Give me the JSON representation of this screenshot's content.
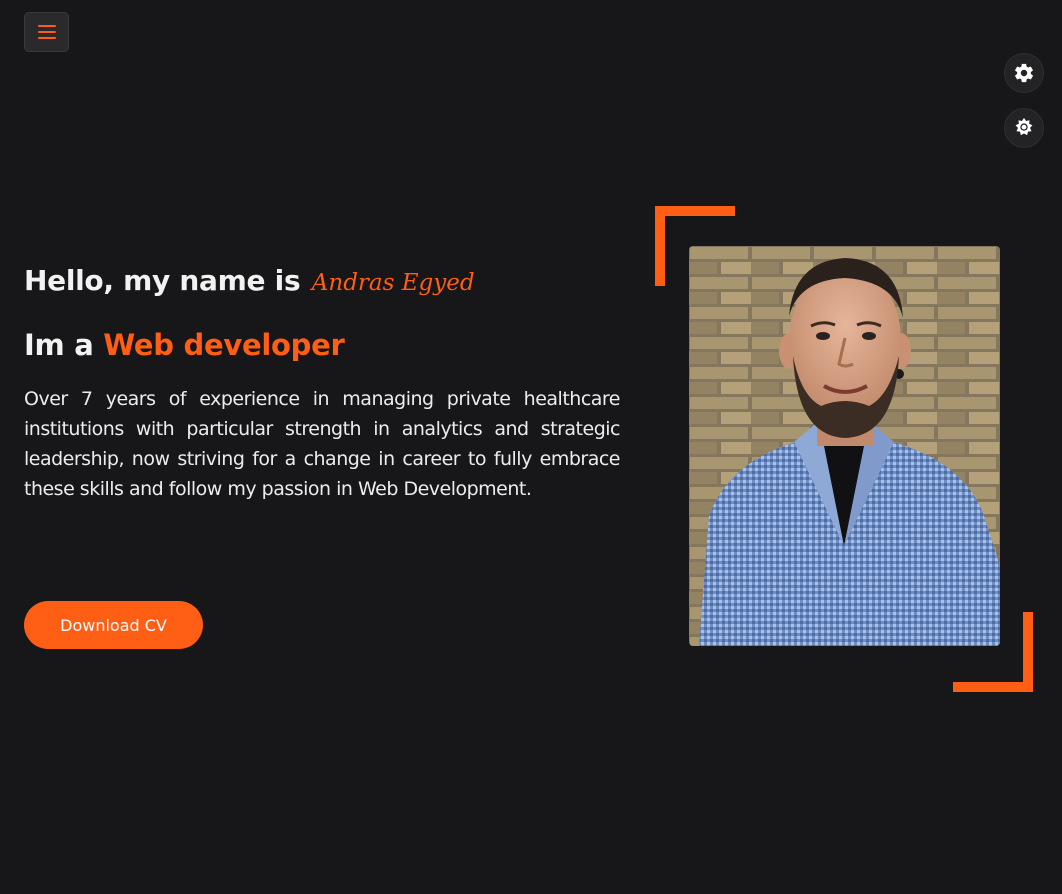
{
  "header": {
    "menu_icon": "hamburger-menu-icon",
    "settings_icon": "gear-icon",
    "theme_icon": "sun-icon"
  },
  "hero": {
    "greeting": "Hello, my name is",
    "name": "Andras Egyed",
    "role_prefix": "Im a",
    "role": "Web developer",
    "about": "Over 7 years of experience in managing private healthcare institutions with particular strength in analytics and strategic leadership, now striving for a change in career to fully embrace these skills and follow my passion in Web Development.",
    "cv_button": "Download CV"
  },
  "colors": {
    "accent": "#ff5e14",
    "background": "#171618",
    "text": "#f2f2f2"
  }
}
